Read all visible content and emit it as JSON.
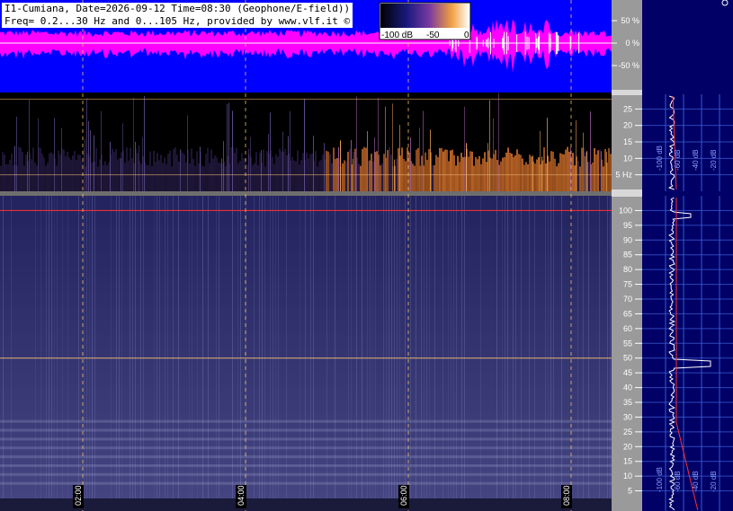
{
  "header": {
    "line1": "I1-Cumiana, Date=2026-09-12 Time=08:30 (Geophone/E-field))",
    "line2": "Freq= 0.2...30 Hz and 0...105 Hz, provided by www.vlf.it ©"
  },
  "colorbar": {
    "labels": [
      "-100 dB",
      "-50",
      "0"
    ]
  },
  "colors": {
    "waveform_bg": "#0000ff",
    "waveform": "#ff00ff",
    "panel_bg": "#000066",
    "axis_bg": "#9a9a9a",
    "marker": "#ff3030",
    "time_line": "#ffc864"
  },
  "chart_data": [
    {
      "type": "area",
      "name": "waveform",
      "ylabel": "",
      "yticks": [
        50,
        0,
        -50
      ],
      "yticklabels": [
        "50 %",
        "0 %",
        "-50 %"
      ],
      "ylim": [
        -100,
        100
      ]
    },
    {
      "type": "heatmap",
      "name": "elf-spectrogram",
      "ylim": [
        0,
        30
      ],
      "yticks": [
        5,
        10,
        15,
        20,
        25
      ],
      "yticklabels": [
        "5 Hz",
        "10",
        "15",
        "20",
        "25"
      ],
      "markers": [
        5,
        28
      ]
    },
    {
      "type": "heatmap",
      "name": "ulf-spectrogram",
      "ylim": [
        0,
        105
      ],
      "yticks": [
        5,
        10,
        15,
        20,
        25,
        30,
        35,
        40,
        45,
        50,
        55,
        60,
        65,
        70,
        75,
        80,
        85,
        90,
        95,
        100
      ],
      "yticklabels": [
        "5",
        "10",
        "15",
        "20",
        "25",
        "30",
        "35",
        "40",
        "45",
        "50",
        "55",
        "60",
        "65",
        "70",
        "75",
        "80",
        "85",
        "90",
        "95",
        "100"
      ],
      "markers": [
        50,
        100
      ],
      "xticklabels": [
        "02:00",
        "04:00",
        "06:00",
        "08:00"
      ]
    },
    {
      "type": "line",
      "name": "spectrum-top",
      "xticklabels": [
        "-100 dB",
        "-60 dB",
        "-40 dB",
        "-20 dB"
      ]
    },
    {
      "type": "line",
      "name": "spectrum-bottom",
      "xticklabels": [
        "-100 dB",
        "-60 dB",
        "-40 dB",
        "-20 dB"
      ]
    }
  ]
}
